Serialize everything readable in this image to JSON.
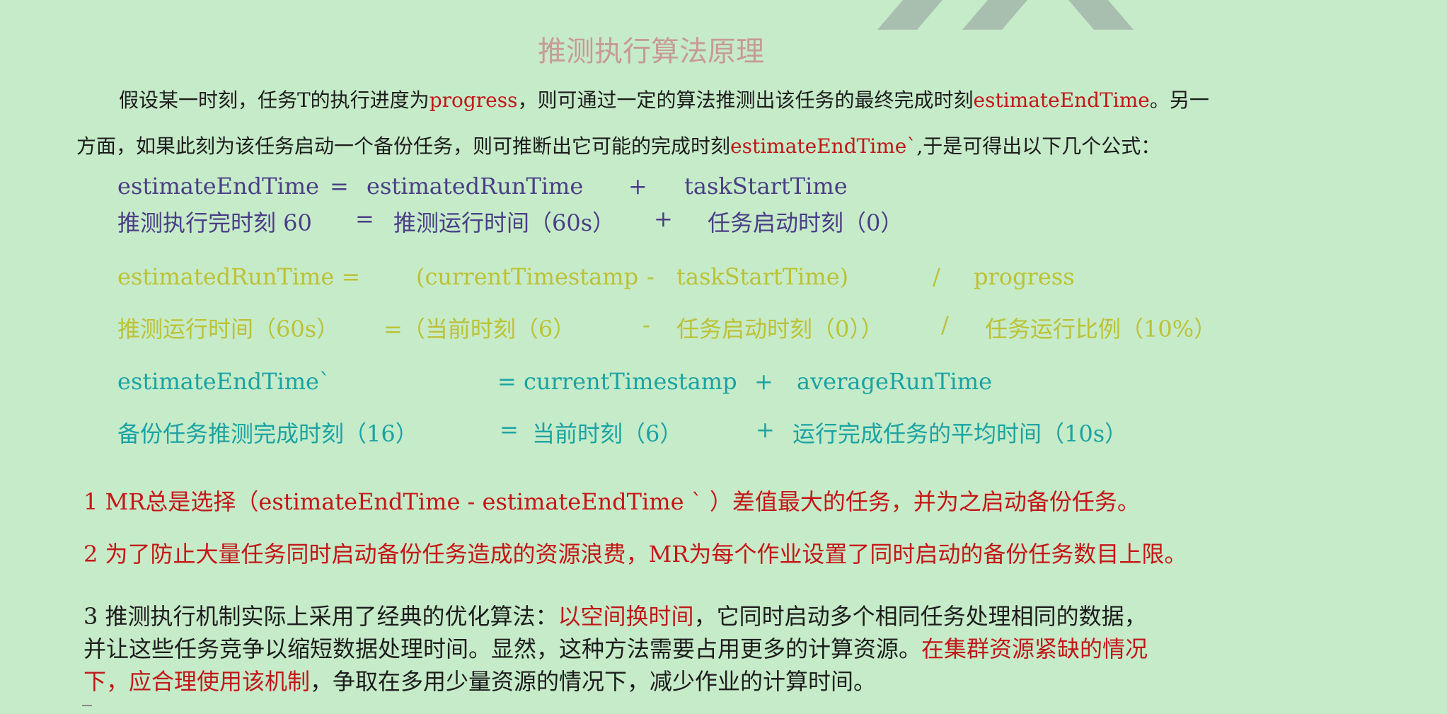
{
  "title": "推测执行算法原理",
  "intro": {
    "line1": [
      {
        "text": "假设某一时刻，任务T的执行进度为",
        "color": "#1c1c1c"
      },
      {
        "text": "progress",
        "color": "#c01818"
      },
      {
        "text": "，则可通过一定的算法推测出该任务的最终完成时刻",
        "color": "#1c1c1c"
      },
      {
        "text": "estimateEndTime",
        "color": "#c01818"
      },
      {
        "text": "。另一",
        "color": "#1c1c1c"
      }
    ],
    "line2": [
      {
        "text": "方面，如果此刻为该任务启动一个备份任务，则可推断出它可能的完成时刻",
        "color": "#1c1c1c"
      },
      {
        "text": "estimateEndTime`",
        "color": "#c01818"
      },
      {
        "text": ",于是可得出以下几个公式：",
        "color": "#1c1c1c"
      }
    ]
  },
  "formula1": {
    "name": "estimateEndTime",
    "eq": "=",
    "term1": "estimatedRunTime",
    "op": "+",
    "term2": "taskStartTime",
    "cn_name": "推测执行完时刻 60",
    "cn_eq": "=",
    "cn_term1": "推测运行时间（60s）",
    "cn_op": "+",
    "cn_term2": "任务启动时刻（0）"
  },
  "formula2": {
    "name": "estimatedRunTime =",
    "term1": "(currentTimestamp",
    "minus": "-",
    "term2": "taskStartTime)",
    "div": "/",
    "term3": "progress",
    "cn_name": "推测运行时间（60s）",
    "cn_eq": "=（当前时刻（6）",
    "cn_minus": "-",
    "cn_term2": "任务启动时刻（0））",
    "cn_div": "/",
    "cn_term3": "任务运行比例（10%）"
  },
  "formula3": {
    "name": "estimateEndTime`",
    "eq_term1": "= currentTimestamp",
    "op": "+",
    "term2": "averageRunTime",
    "cn_name": "备份任务推测完成时刻（16）",
    "cn_eq": "=",
    "cn_term1": "当前时刻（6）",
    "cn_op": "+",
    "cn_term2": "运行完成任务的平均时间（10s）"
  },
  "notes": {
    "n1": "1 MR总是选择（estimateEndTime - estimateEndTime ` ）差值最大的任务，并为之启动备份任务。",
    "n2": "2 为了防止大量任务同时启动备份任务造成的资源浪费，MR为每个作业设置了同时启动的备份任务数目上限。"
  },
  "point3": {
    "line1": [
      {
        "text": "3 推测执行机制实际上采用了经典的优化算法：",
        "color": "#1c1c1c"
      },
      {
        "text": "以空间换时间",
        "color": "#c01818"
      },
      {
        "text": "，它同时启动多个相同任务处理相同的数据，",
        "color": "#1c1c1c"
      }
    ],
    "line2": [
      {
        "text": "并让这些任务竞争以缩短数据处理时间。显然，这种方法需要占用更多的计算资源。",
        "color": "#1c1c1c"
      },
      {
        "text": "在集群资源紧缺的情况",
        "color": "#c01818"
      }
    ],
    "line3": [
      {
        "text": "下，应合理使用该机制",
        "color": "#c01818"
      },
      {
        "text": "，争取在多用少量资源的情况下，减少作业的计算时间。",
        "color": "#1c1c1c"
      }
    ]
  }
}
